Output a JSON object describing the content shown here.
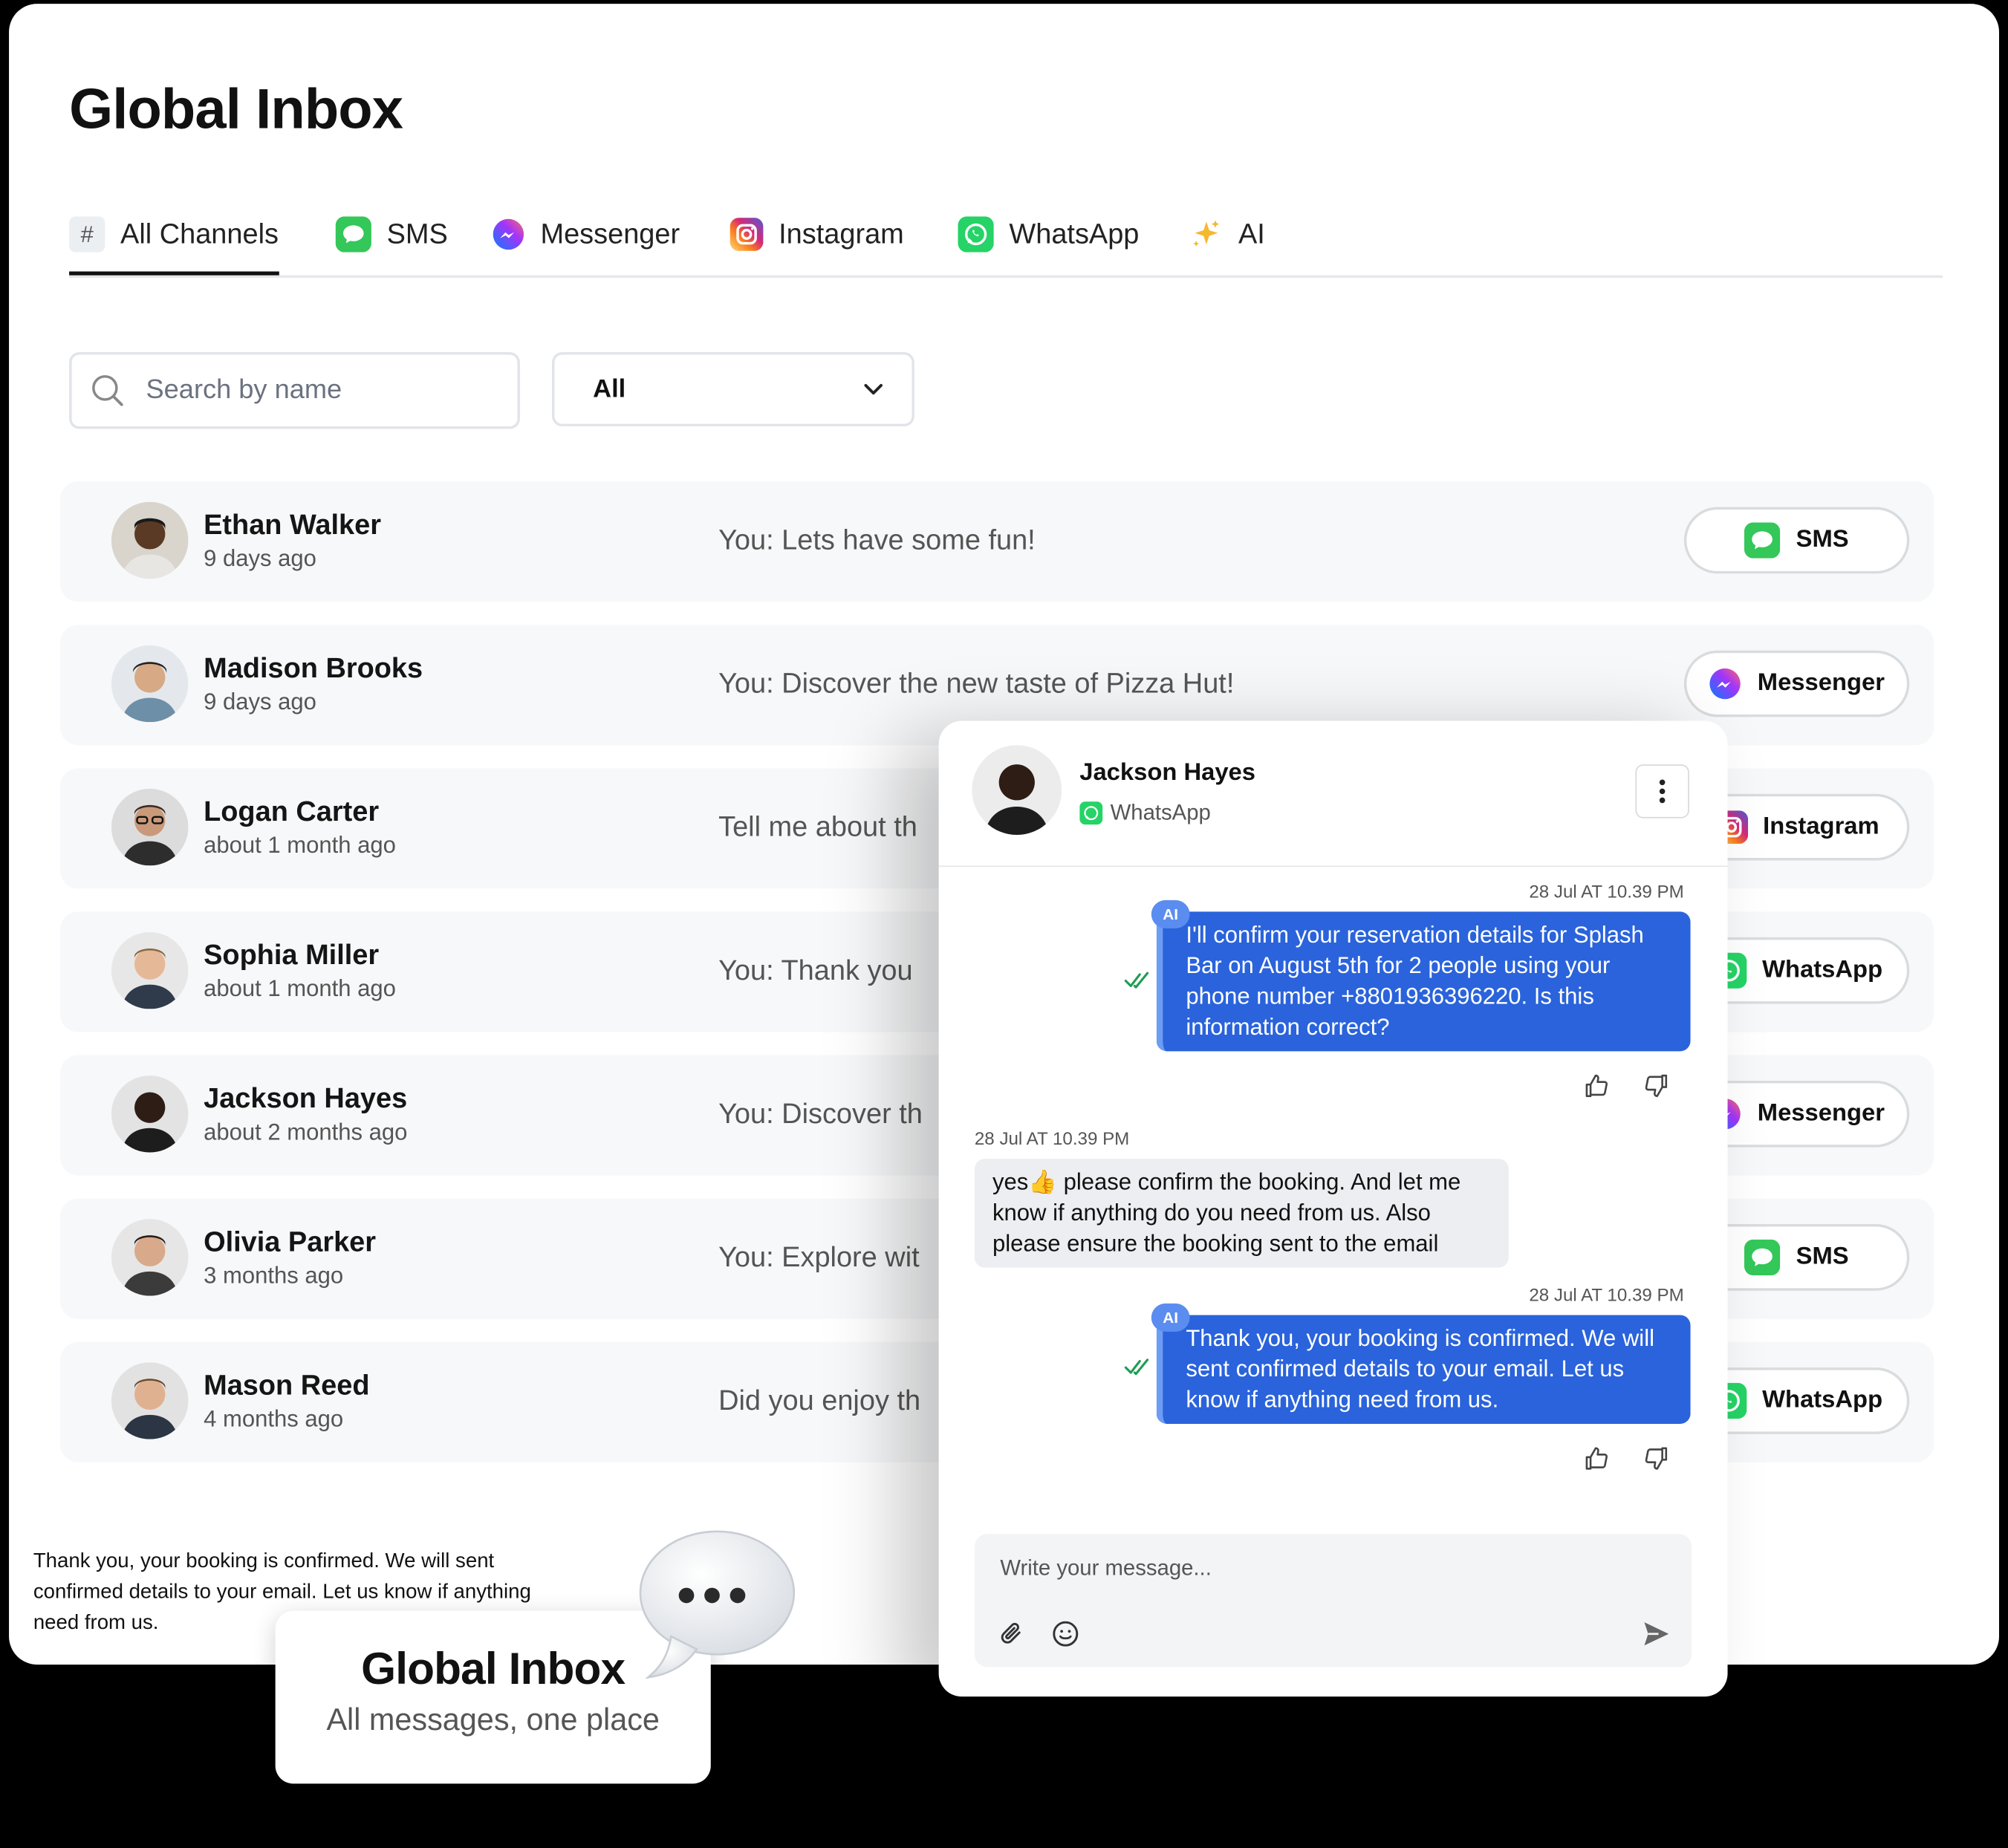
{
  "page_title": "Global Inbox",
  "tabs": [
    {
      "label": "All Channels",
      "icon": "hash-icon"
    },
    {
      "label": "SMS",
      "icon": "sms-icon"
    },
    {
      "label": "Messenger",
      "icon": "messenger-icon"
    },
    {
      "label": "Instagram",
      "icon": "instagram-icon"
    },
    {
      "label": "WhatsApp",
      "icon": "whatsapp-icon"
    },
    {
      "label": "AI",
      "icon": "sparkle-icon"
    }
  ],
  "search": {
    "placeholder": "Search by name"
  },
  "filter": {
    "selected": "All"
  },
  "conversations": [
    {
      "name": "Ethan Walker",
      "time": "9 days ago",
      "preview": "You: Lets have some fun!",
      "channel": "SMS"
    },
    {
      "name": "Madison Brooks",
      "time": "9 days ago",
      "preview": "You: Discover the new taste of Pizza Hut!",
      "channel": "Messenger"
    },
    {
      "name": "Logan Carter",
      "time": "about 1 month ago",
      "preview": "Tell me about th",
      "channel": "Instagram"
    },
    {
      "name": "Sophia Miller",
      "time": "about 1 month ago",
      "preview": "You: Thank you",
      "channel": "WhatsApp"
    },
    {
      "name": "Jackson Hayes",
      "time": "about 2 months ago",
      "preview": "You: Discover th",
      "channel": "Messenger"
    },
    {
      "name": "Olivia Parker",
      "time": "3 months ago",
      "preview": "You: Explore wit",
      "channel": "SMS"
    },
    {
      "name": "Mason Reed",
      "time": "4 months ago",
      "preview": "Did you enjoy th",
      "channel": "WhatsApp"
    }
  ],
  "chat": {
    "contact_name": "Jackson Hayes",
    "contact_channel": "WhatsApp",
    "messages": [
      {
        "direction": "out",
        "ai_badge": "AI",
        "timestamp": "28 Jul AT 10.39 PM",
        "text": "I'll confirm your reservation details for Splash Bar on August 5th for 2 people using your phone number +8801936396220. Is this information correct?"
      },
      {
        "direction": "in",
        "timestamp": "28 Jul AT 10.39 PM",
        "text": "yes👍 please confirm the booking. And let me know if anything do you need from us. Also please ensure the booking sent to the email"
      },
      {
        "direction": "out",
        "ai_badge": "AI",
        "timestamp": "28 Jul AT 10.39 PM",
        "text": "Thank you, your booking is confirmed. We will sent confirmed details to your email. Let us know if anything need from us."
      }
    ],
    "composer_placeholder": "Write your message..."
  },
  "caption": "Thank you, your booking is confirmed. We will sent confirmed details to your email. Let us know if anything need from us.",
  "promo": {
    "title": "Global Inbox",
    "subtitle": "All messages, one place"
  },
  "colors": {
    "sms": "#34c759",
    "whatsapp": "#25d366",
    "messenger": "#a334fa",
    "instagram": "#e1306c",
    "ai_bubble": "#2a63db",
    "ai_sparkle": "#f5b82e"
  }
}
